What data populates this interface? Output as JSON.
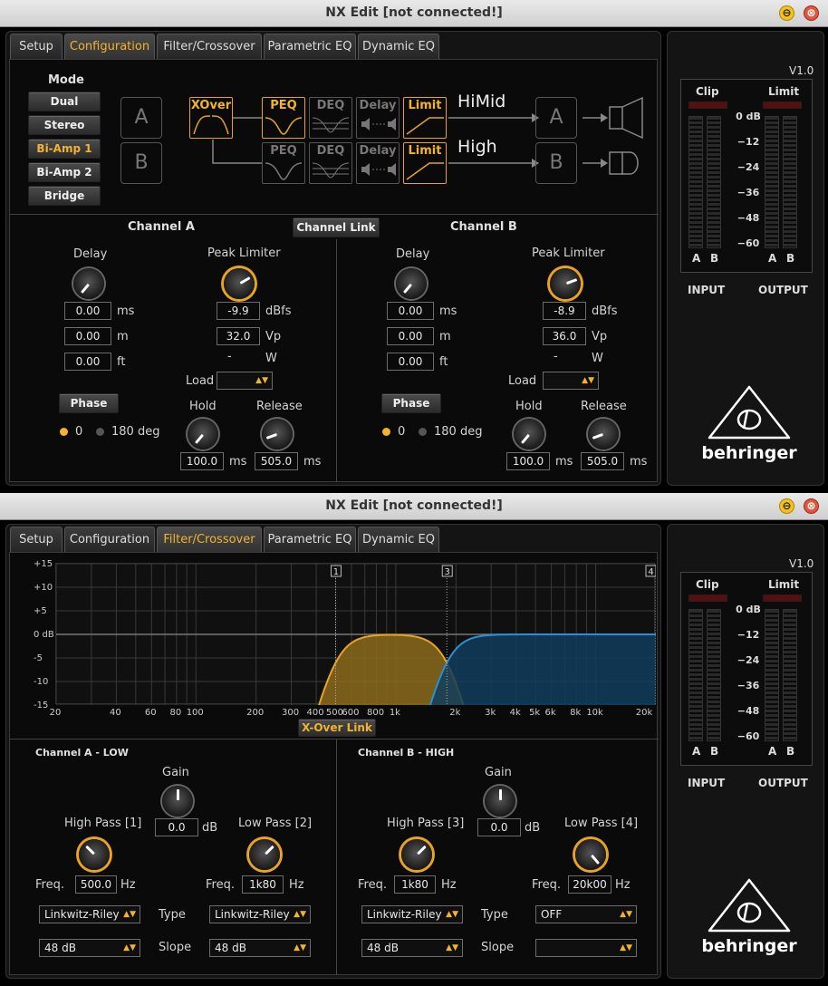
{
  "app_title": "NX Edit [not connected!]",
  "window_buttons": {
    "minimize": "⊖",
    "close": "⊗"
  },
  "tabs": [
    "Setup",
    "Configuration",
    "Filter/Crossover",
    "Parametric EQ",
    "Dynamic EQ"
  ],
  "colors": {
    "accent": "#f4b32c",
    "channel_a_fill": "#8a6a1c",
    "channel_b_fill": "#0f3c5c"
  },
  "meters": {
    "version": "V1.0",
    "clip_label": "Clip",
    "limit_label": "Limit",
    "scale": [
      "0 dB",
      "−12",
      "−24",
      "−36",
      "−48",
      "−60"
    ],
    "a": "A",
    "b": "B",
    "input_label": "INPUT",
    "output_label": "OUTPUT",
    "logo_text": "behringer"
  },
  "config": {
    "mode_label": "Mode",
    "modes": [
      "Dual",
      "Stereo",
      "Bi-Amp 1",
      "Bi-Amp 2",
      "Bridge"
    ],
    "selected_mode": "Bi-Amp 1",
    "in_a": "A",
    "in_b": "B",
    "xover": "XOver",
    "peq": "PEQ",
    "deq": "DEQ",
    "delay": "Delay",
    "limit": "Limit",
    "out_a_name": "HiMid",
    "out_b_name": "High",
    "out_a": "A",
    "out_b": "B",
    "channel_link": "Channel Link",
    "channel_a": {
      "title": "Channel A",
      "delay_label": "Delay",
      "delay_ms": "0.00",
      "delay_m": "0.00",
      "delay_ft": "0.00",
      "peak_label": "Peak Limiter",
      "peak_dbfs": "-9.9",
      "peak_vp": "32.0",
      "peak_w": "-",
      "load_label": "Load",
      "phase_label": "Phase",
      "phase_0": "0",
      "phase_180": "180 deg",
      "hold_label": "Hold",
      "hold_ms": "100.0",
      "release_label": "Release",
      "release_ms": "505.0"
    },
    "channel_b": {
      "title": "Channel B",
      "delay_label": "Delay",
      "delay_ms": "0.00",
      "delay_m": "0.00",
      "delay_ft": "0.00",
      "peak_label": "Peak Limiter",
      "peak_dbfs": "-8.9",
      "peak_vp": "36.0",
      "peak_w": "-",
      "load_label": "Load",
      "phase_label": "Phase",
      "phase_0": "0",
      "phase_180": "180 deg",
      "hold_label": "Hold",
      "hold_ms": "100.0",
      "release_label": "Release",
      "release_ms": "505.0"
    },
    "units": {
      "ms": "ms",
      "m": "m",
      "ft": "ft",
      "dbfs": "dBfs",
      "vp": "Vp",
      "w": "W"
    }
  },
  "filter": {
    "xover_link": "X-Over Link",
    "markers": [
      "1",
      "3",
      "4"
    ],
    "units": {
      "db": "dB",
      "hz": "Hz"
    },
    "channel_a": {
      "title": "Channel A - LOW",
      "gain_label": "Gain",
      "gain": "0.0",
      "hp_label": "High Pass [1]",
      "hp_freq": "500.0",
      "lp_label": "Low Pass [2]",
      "lp_freq": "1k80",
      "freq_label": "Freq.",
      "type_label": "Type",
      "hp_type": "Linkwitz-Riley",
      "lp_type": "Linkwitz-Riley",
      "slope_label": "Slope",
      "hp_slope": "48 dB",
      "lp_slope": "48 dB"
    },
    "channel_b": {
      "title": "Channel B - HIGH",
      "gain_label": "Gain",
      "gain": "0.0",
      "hp_label": "High Pass [3]",
      "hp_freq": "1k80",
      "lp_label": "Low Pass [4]",
      "lp_freq": "20k00",
      "freq_label": "Freq.",
      "type_label": "Type",
      "hp_type": "Linkwitz-Riley",
      "lp_type": "OFF",
      "slope_label": "Slope",
      "hp_slope": "48 dB",
      "lp_slope": ""
    }
  },
  "chart_data": {
    "type": "area",
    "x_scale": "log",
    "xlim": [
      20,
      20000
    ],
    "ylim": [
      -15,
      15
    ],
    "y_ticks": [
      "+15",
      "+10",
      "+5",
      "0 dB",
      "-5",
      "-10",
      "-15"
    ],
    "y_tick_values": [
      15,
      10,
      5,
      0,
      -5,
      -10,
      -15
    ],
    "x_ticks": [
      "20",
      "40",
      "60",
      "80",
      "100",
      "200",
      "300",
      "400",
      "500",
      "600",
      "800",
      "1k",
      "2k",
      "3k",
      "4k",
      "5k",
      "6k",
      "8k",
      "10k",
      "20k"
    ],
    "x_tick_values": [
      20,
      40,
      60,
      80,
      100,
      200,
      300,
      400,
      500,
      600,
      800,
      1000,
      2000,
      3000,
      4000,
      5000,
      6000,
      8000,
      10000,
      20000
    ],
    "markers": [
      {
        "label": "1",
        "freq": 500
      },
      {
        "label": "3",
        "freq": 1800
      },
      {
        "label": "4",
        "freq": 20000
      }
    ],
    "series": [
      {
        "hp": 500,
        "lp": 1800,
        "color": "#e8a324"
      },
      {
        "hp": 1800,
        "lp": null,
        "color": "#2e8fd0"
      }
    ]
  }
}
